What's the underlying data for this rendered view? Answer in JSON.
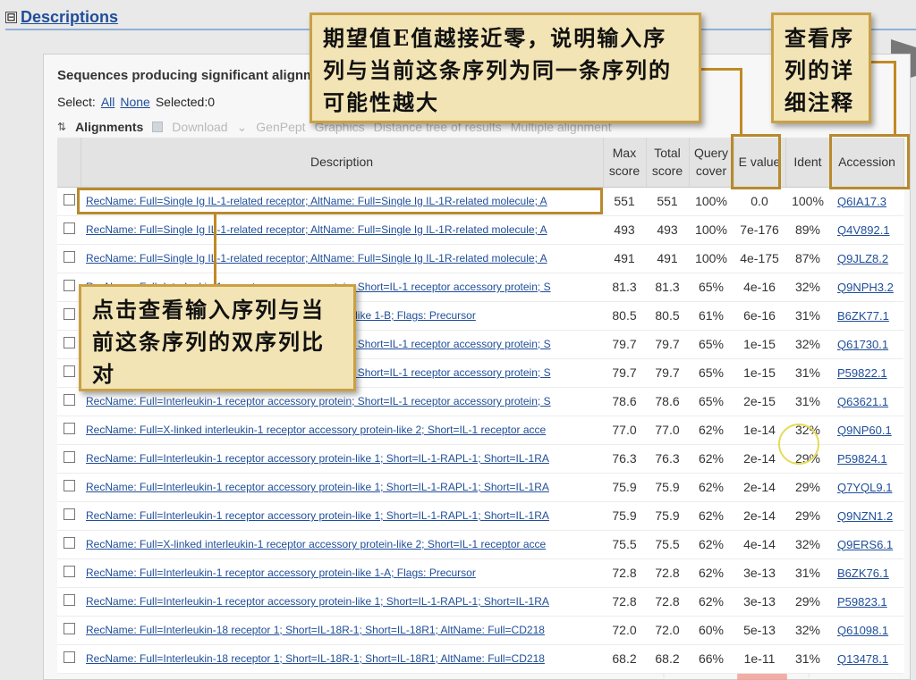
{
  "section": {
    "title": "Descriptions",
    "toggle": "⊟"
  },
  "panel": {
    "title": "Sequences producing significant alignme",
    "select_label": "Select:",
    "select_all": "All",
    "select_none": "None",
    "selected": "Selected:0"
  },
  "toolbar": {
    "alignments": "Alignments",
    "download": "Download",
    "download_caret": "⌄",
    "genpept": "GenPept",
    "graphics": "Graphics",
    "distance_tree": "Distance tree of results",
    "multiple_alignment": "Multiple alignment"
  },
  "table": {
    "headers": {
      "description": "Description",
      "max_score": "Max score",
      "total_score": "Total score",
      "query_cover": "Query cover",
      "e_value": "E value",
      "ident": "Ident",
      "accession": "Accession"
    },
    "rows": [
      {
        "desc": "RecName: Full=Single Ig IL-1-related receptor; AltName: Full=Single Ig IL-1R-related molecule; A",
        "max": "551",
        "total": "551",
        "cover": "100%",
        "e": "0.0",
        "ident": "100%",
        "acc": "Q6IA17.3"
      },
      {
        "desc": "RecName: Full=Single Ig IL-1-related receptor; AltName: Full=Single Ig IL-1R-related molecule; A",
        "max": "493",
        "total": "493",
        "cover": "100%",
        "e": "7e-176",
        "ident": "89%",
        "acc": "Q4V892.1"
      },
      {
        "desc": "RecName: Full=Single Ig IL-1-related receptor; AltName: Full=Single Ig IL-1R-related molecule; A",
        "max": "491",
        "total": "491",
        "cover": "100%",
        "e": "4e-175",
        "ident": "87%",
        "acc": "Q9JLZ8.2"
      },
      {
        "desc": "RecName: Full=Interleukin-1 receptor accessory protein; Short=IL-1 receptor accessory protein; S",
        "max": "81.3",
        "total": "81.3",
        "cover": "65%",
        "e": "4e-16",
        "ident": "32%",
        "acc": "Q9NPH3.2"
      },
      {
        "desc": "RecName: Full=Interleukin-1 receptor accessory protein-like 1-B; Flags: Precursor",
        "max": "80.5",
        "total": "80.5",
        "cover": "61%",
        "e": "6e-16",
        "ident": "31%",
        "acc": "B6ZK77.1"
      },
      {
        "desc": "RecName: Full=Interleukin-1 receptor accessory protein; Short=IL-1 receptor accessory protein; S",
        "max": "79.7",
        "total": "79.7",
        "cover": "65%",
        "e": "1e-15",
        "ident": "32%",
        "acc": "Q61730.1"
      },
      {
        "desc": "RecName: Full=Interleukin-1 receptor accessory protein; Short=IL-1 receptor accessory protein; S",
        "max": "79.7",
        "total": "79.7",
        "cover": "65%",
        "e": "1e-15",
        "ident": "31%",
        "acc": "P59822.1"
      },
      {
        "desc": "RecName: Full=Interleukin-1 receptor accessory protein; Short=IL-1 receptor accessory protein; S",
        "max": "78.6",
        "total": "78.6",
        "cover": "65%",
        "e": "2e-15",
        "ident": "31%",
        "acc": "Q63621.1"
      },
      {
        "desc": "RecName: Full=X-linked interleukin-1 receptor accessory protein-like 2; Short=IL-1 receptor acce",
        "max": "77.0",
        "total": "77.0",
        "cover": "62%",
        "e": "1e-14",
        "ident": "32%",
        "acc": "Q9NP60.1"
      },
      {
        "desc": "RecName: Full=Interleukin-1 receptor accessory protein-like 1; Short=IL-1-RAPL-1; Short=IL-1RA",
        "max": "76.3",
        "total": "76.3",
        "cover": "62%",
        "e": "2e-14",
        "ident": "29%",
        "acc": "P59824.1"
      },
      {
        "desc": "RecName: Full=Interleukin-1 receptor accessory protein-like 1; Short=IL-1-RAPL-1; Short=IL-1RA",
        "max": "75.9",
        "total": "75.9",
        "cover": "62%",
        "e": "2e-14",
        "ident": "29%",
        "acc": "Q7YQL9.1"
      },
      {
        "desc": "RecName: Full=Interleukin-1 receptor accessory protein-like 1; Short=IL-1-RAPL-1; Short=IL-1RA",
        "max": "75.9",
        "total": "75.9",
        "cover": "62%",
        "e": "2e-14",
        "ident": "29%",
        "acc": "Q9NZN1.2"
      },
      {
        "desc": "RecName: Full=X-linked interleukin-1 receptor accessory protein-like 2; Short=IL-1 receptor acce",
        "max": "75.5",
        "total": "75.5",
        "cover": "62%",
        "e": "4e-14",
        "ident": "32%",
        "acc": "Q9ERS6.1"
      },
      {
        "desc": "RecName: Full=Interleukin-1 receptor accessory protein-like 1-A; Flags: Precursor",
        "max": "72.8",
        "total": "72.8",
        "cover": "62%",
        "e": "3e-13",
        "ident": "31%",
        "acc": "B6ZK76.1"
      },
      {
        "desc": "RecName: Full=Interleukin-1 receptor accessory protein-like 1; Short=IL-1-RAPL-1; Short=IL-1RA",
        "max": "72.8",
        "total": "72.8",
        "cover": "62%",
        "e": "3e-13",
        "ident": "29%",
        "acc": "P59823.1"
      },
      {
        "desc": "RecName: Full=Interleukin-18 receptor 1; Short=IL-18R-1; Short=IL-18R1; AltName: Full=CD218",
        "max": "72.0",
        "total": "72.0",
        "cover": "60%",
        "e": "5e-13",
        "ident": "32%",
        "acc": "Q61098.1"
      },
      {
        "desc": "RecName: Full=Interleukin-18 receptor 1; Short=IL-18R-1; Short=IL-18R1; AltName: Full=CD218",
        "max": "68.2",
        "total": "68.2",
        "cover": "66%",
        "e": "1e-11",
        "ident": "31%",
        "acc": "Q13478.1"
      }
    ]
  },
  "annotations": {
    "evalue_note": "期望值E值越接近零，说明输入序列与当前这条序列为同一条序列的可能性越大",
    "accession_note": "查看序列的详细注释",
    "alignment_note": "点击查看输入序列与当前这条序列的双序列比对"
  },
  "colors": {
    "link": "#1f4e9a",
    "note_bg": "#f2e4b4",
    "note_border": "#caa045",
    "green_wedge": "#a8d39a",
    "red_wedge": "#f0a198"
  }
}
